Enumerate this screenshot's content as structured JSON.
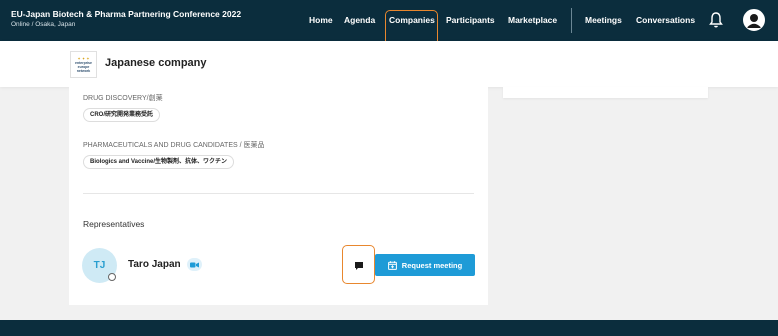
{
  "header": {
    "event_title": "EU-Japan Biotech & Pharma Partnering Conference 2022",
    "event_location": "Online / Osaka, Japan",
    "nav_items": [
      {
        "label": "Home"
      },
      {
        "label": "Agenda"
      },
      {
        "label": "Companies"
      },
      {
        "label": "Participants"
      },
      {
        "label": "Marketplace"
      },
      {
        "label": "Meetings"
      },
      {
        "label": "Conversations"
      }
    ],
    "active_item": "Companies",
    "bell_icon": "bell-icon",
    "avatar_icon": "user-avatar-icon"
  },
  "company": {
    "name": "Japanese company",
    "logo_lines": [
      "enterprise",
      "europe",
      "network"
    ]
  },
  "categories": [
    {
      "label": "DRUG DISCOVERY/創薬",
      "tags": [
        "CRO/研究開発業務受託"
      ]
    },
    {
      "label": "PHARMACEUTICALS AND DRUG CANDIDATES / 医薬品",
      "tags": [
        "Biologics and Vaccine/生物製剤、抗体、ワクチン"
      ]
    }
  ],
  "representatives": {
    "title": "Representatives",
    "people": [
      {
        "initials": "TJ",
        "name": "Taro Japan",
        "video_icon": "video-camera-icon",
        "chat_icon": "chat-bubble-icon"
      }
    ],
    "request_meeting_label": "Request meeting",
    "request_icon": "calendar-plus-icon"
  },
  "colors": {
    "nav_bg": "#0b2d3d",
    "accent": "#1e9bd7",
    "highlight": "#e8872e"
  }
}
